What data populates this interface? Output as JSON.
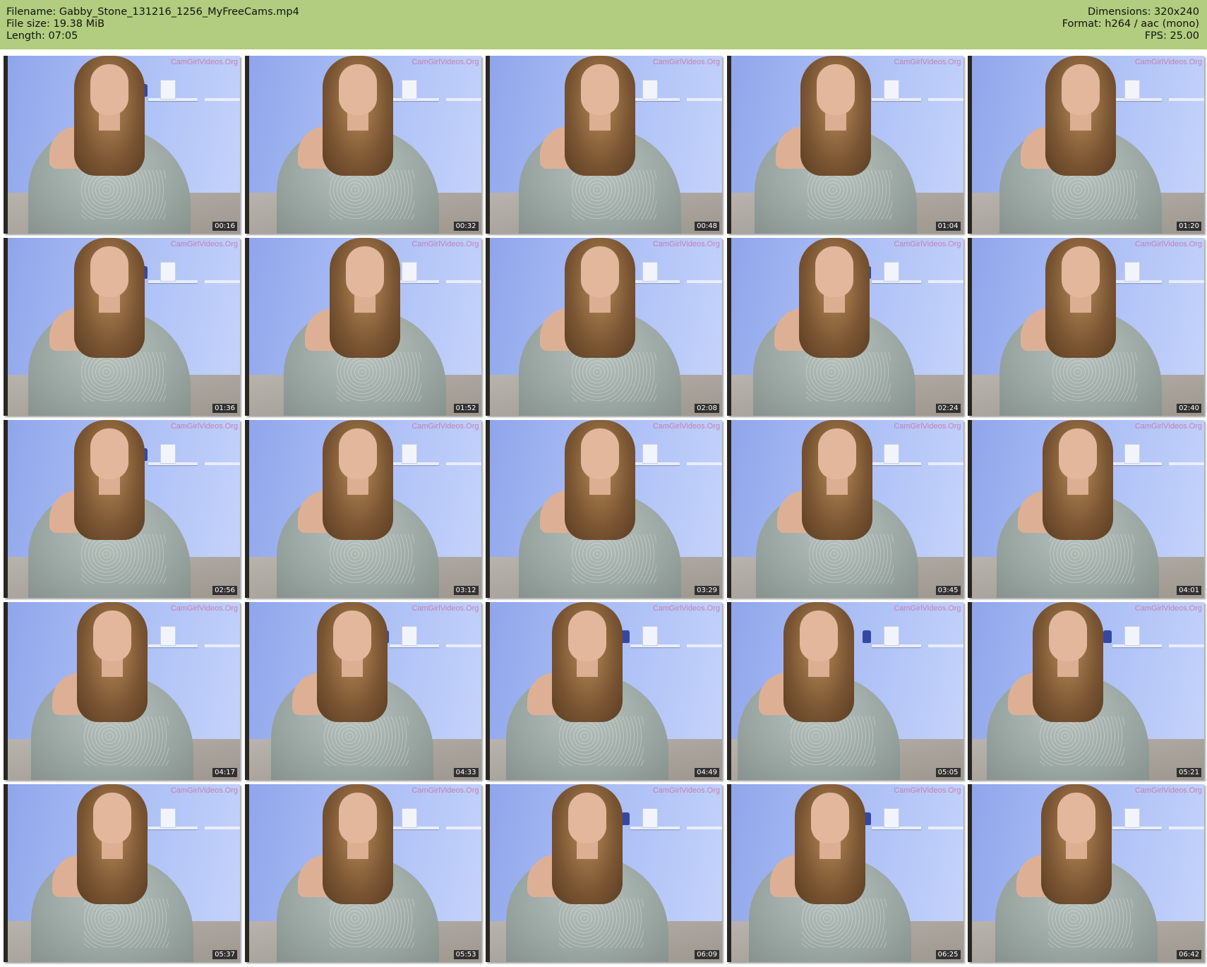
{
  "header": {
    "filename": "Filename: Gabby_Stone_131216_1256_MyFreeCams.mp4",
    "filesize": "File size: 19.38 MiB",
    "length": "Length: 07:05",
    "dimensions": "Dimensions: 320x240",
    "format": "Format: h264 / aac (mono)",
    "fps": "FPS: 25.00",
    "background_color": "#b2cd7f"
  },
  "thumbnails": {
    "watermark": "CamGirlVideos.Org",
    "timestamps": [
      "00:16",
      "00:32",
      "00:48",
      "01:04",
      "01:20",
      "01:36",
      "01:52",
      "02:08",
      "02:24",
      "02:40",
      "02:56",
      "03:12",
      "03:29",
      "03:45",
      "04:01",
      "04:17",
      "04:33",
      "04:49",
      "05:05",
      "05:21",
      "05:37",
      "05:53",
      "06:09",
      "06:25",
      "06:42"
    ]
  }
}
